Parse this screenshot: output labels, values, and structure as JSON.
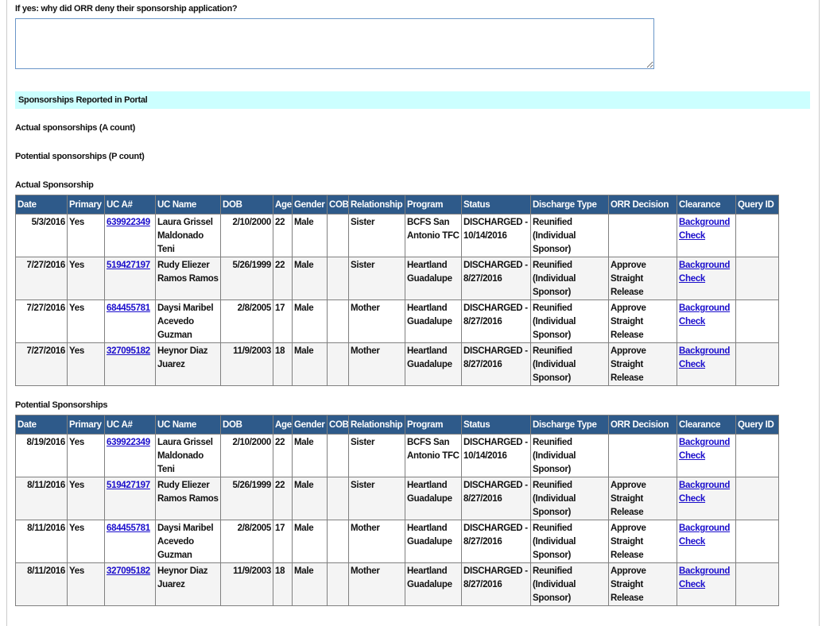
{
  "question": {
    "label": "If yes: why did ORR deny their sponsorship application?",
    "value": ""
  },
  "section_title": "Sponsorships Reported in Portal",
  "actual_count_label": "Actual sponsorships (A count)",
  "potential_count_label": "Potential sponsorships (P count)",
  "columns": [
    "Date",
    "Primary",
    "UC A#",
    "UC Name",
    "DOB",
    "Age",
    "Gender",
    "COB",
    "Relationship",
    "Program",
    "Status",
    "Discharge Type",
    "ORR Decision",
    "Clearance",
    "Query ID"
  ],
  "actual": {
    "title": "Actual Sponsorship",
    "rows": [
      [
        "5/3/2016",
        "Yes",
        "639922349",
        "Laura Grissel Maldonado Teni",
        "2/10/2000",
        "22",
        "Male",
        "",
        "Sister",
        "BCFS San Antonio TFC",
        "DISCHARGED - 10/14/2016",
        "Reunified (Individual Sponsor)",
        "",
        "Background Check",
        ""
      ],
      [
        "7/27/2016",
        "Yes",
        "519427197",
        "Rudy Eliezer Ramos Ramos",
        "5/26/1999",
        "22",
        "Male",
        "",
        "Sister",
        "Heartland Guadalupe",
        "DISCHARGED - 8/27/2016",
        "Reunified (Individual Sponsor)",
        "Approve Straight Release",
        "Background Check",
        ""
      ],
      [
        "7/27/2016",
        "Yes",
        "684455781",
        "Daysi Maribel Acevedo Guzman",
        "2/8/2005",
        "17",
        "Male",
        "",
        "Mother",
        "Heartland Guadalupe",
        "DISCHARGED - 8/27/2016",
        "Reunified (Individual Sponsor)",
        "Approve Straight Release",
        "Background Check",
        ""
      ],
      [
        "7/27/2016",
        "Yes",
        "327095182",
        "Heynor Diaz Juarez",
        "11/9/2003",
        "18",
        "Male",
        "",
        "Mother",
        "Heartland Guadalupe",
        "DISCHARGED - 8/27/2016",
        "Reunified (Individual Sponsor)",
        "Approve Straight Release",
        "Background Check",
        ""
      ]
    ]
  },
  "potential": {
    "title": "Potential Sponsorships",
    "rows": [
      [
        "8/19/2016",
        "Yes",
        "639922349",
        "Laura Grissel Maldonado Teni",
        "2/10/2000",
        "22",
        "Male",
        "",
        "Sister",
        "BCFS San Antonio TFC",
        "DISCHARGED - 10/14/2016",
        "Reunified (Individual Sponsor)",
        "",
        "Background Check",
        ""
      ],
      [
        "8/11/2016",
        "Yes",
        "519427197",
        "Rudy Eliezer Ramos Ramos",
        "5/26/1999",
        "22",
        "Male",
        "",
        "Sister",
        "Heartland Guadalupe",
        "DISCHARGED - 8/27/2016",
        "Reunified (Individual Sponsor)",
        "Approve Straight Release",
        "Background Check",
        ""
      ],
      [
        "8/11/2016",
        "Yes",
        "684455781",
        "Daysi Maribel Acevedo Guzman",
        "2/8/2005",
        "17",
        "Male",
        "",
        "Mother",
        "Heartland Guadalupe",
        "DISCHARGED - 8/27/2016",
        "Reunified (Individual Sponsor)",
        "Approve Straight Release",
        "Background Check",
        ""
      ],
      [
        "8/11/2016",
        "Yes",
        "327095182",
        "Heynor Diaz Juarez",
        "11/9/2003",
        "18",
        "Male",
        "",
        "Mother",
        "Heartland Guadalupe",
        "DISCHARGED - 8/27/2016",
        "Reunified (Individual Sponsor)",
        "Approve Straight Release",
        "Background Check",
        ""
      ]
    ]
  },
  "colors": {
    "header_bg": "#2e5a8a",
    "section_band": "#ccffff",
    "link": "#1a0dcc"
  }
}
